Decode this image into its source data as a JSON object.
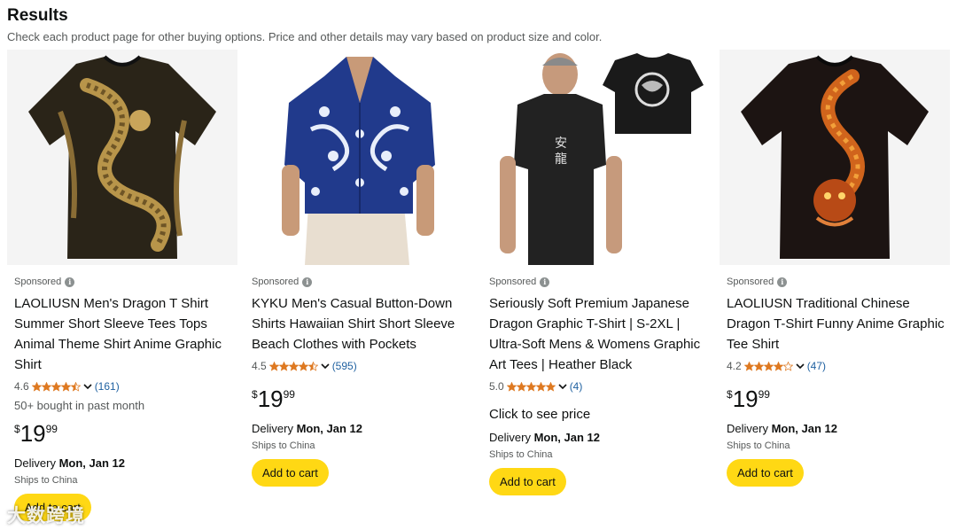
{
  "header": {
    "title": "Results",
    "subtitle": "Check each product page for other buying options. Price and other details may vary based on product size and color."
  },
  "colors": {
    "cart_button": "#ffd814",
    "star": "#de7921",
    "link": "#2162a1"
  },
  "products": [
    {
      "sponsored_label": "Sponsored",
      "title": "LAOLIUSN Men's Dragon T Shirt Summer Short Sleeve Tees Tops Animal Theme Shirt Anime Graphic Shirt",
      "rating": "4.6",
      "stars": 4.5,
      "review_count": "(161)",
      "bought": "50+ bought in past month",
      "price_symbol": "$",
      "price_whole": "19",
      "price_fraction": "99",
      "delivery_prefix": "Delivery",
      "delivery_date": "Mon, Jan 12",
      "ships": "Ships to China",
      "cart_label": "Add to cart"
    },
    {
      "sponsored_label": "Sponsored",
      "title": "KYKU Men's Casual Button-Down Shirts Hawaiian Shirt Short Sleeve Beach Clothes with Pockets",
      "rating": "4.5",
      "stars": 4.5,
      "review_count": "(595)",
      "price_symbol": "$",
      "price_whole": "19",
      "price_fraction": "99",
      "delivery_prefix": "Delivery",
      "delivery_date": "Mon, Jan 12",
      "ships": "Ships to China",
      "cart_label": "Add to cart"
    },
    {
      "sponsored_label": "Sponsored",
      "title": "Seriously Soft Premium Japanese Dragon Graphic T-Shirt | S-2XL | Ultra-Soft Mens & Womens Graphic Art Tees | Heather Black",
      "rating": "5.0",
      "stars": 5,
      "review_count": "(4)",
      "see_price": "Click to see price",
      "delivery_prefix": "Delivery",
      "delivery_date": "Mon, Jan 12",
      "ships": "Ships to China",
      "cart_label": "Add to cart"
    },
    {
      "sponsored_label": "Sponsored",
      "title": "LAOLIUSN Traditional Chinese Dragon T-Shirt Funny Anime Graphic Tee Shirt",
      "rating": "4.2",
      "stars": 4,
      "review_count": "(47)",
      "price_symbol": "$",
      "price_whole": "19",
      "price_fraction": "99",
      "delivery_prefix": "Delivery",
      "delivery_date": "Mon, Jan 12",
      "ships": "Ships to China",
      "cart_label": "Add to cart"
    }
  ],
  "watermark": "大数跨境"
}
